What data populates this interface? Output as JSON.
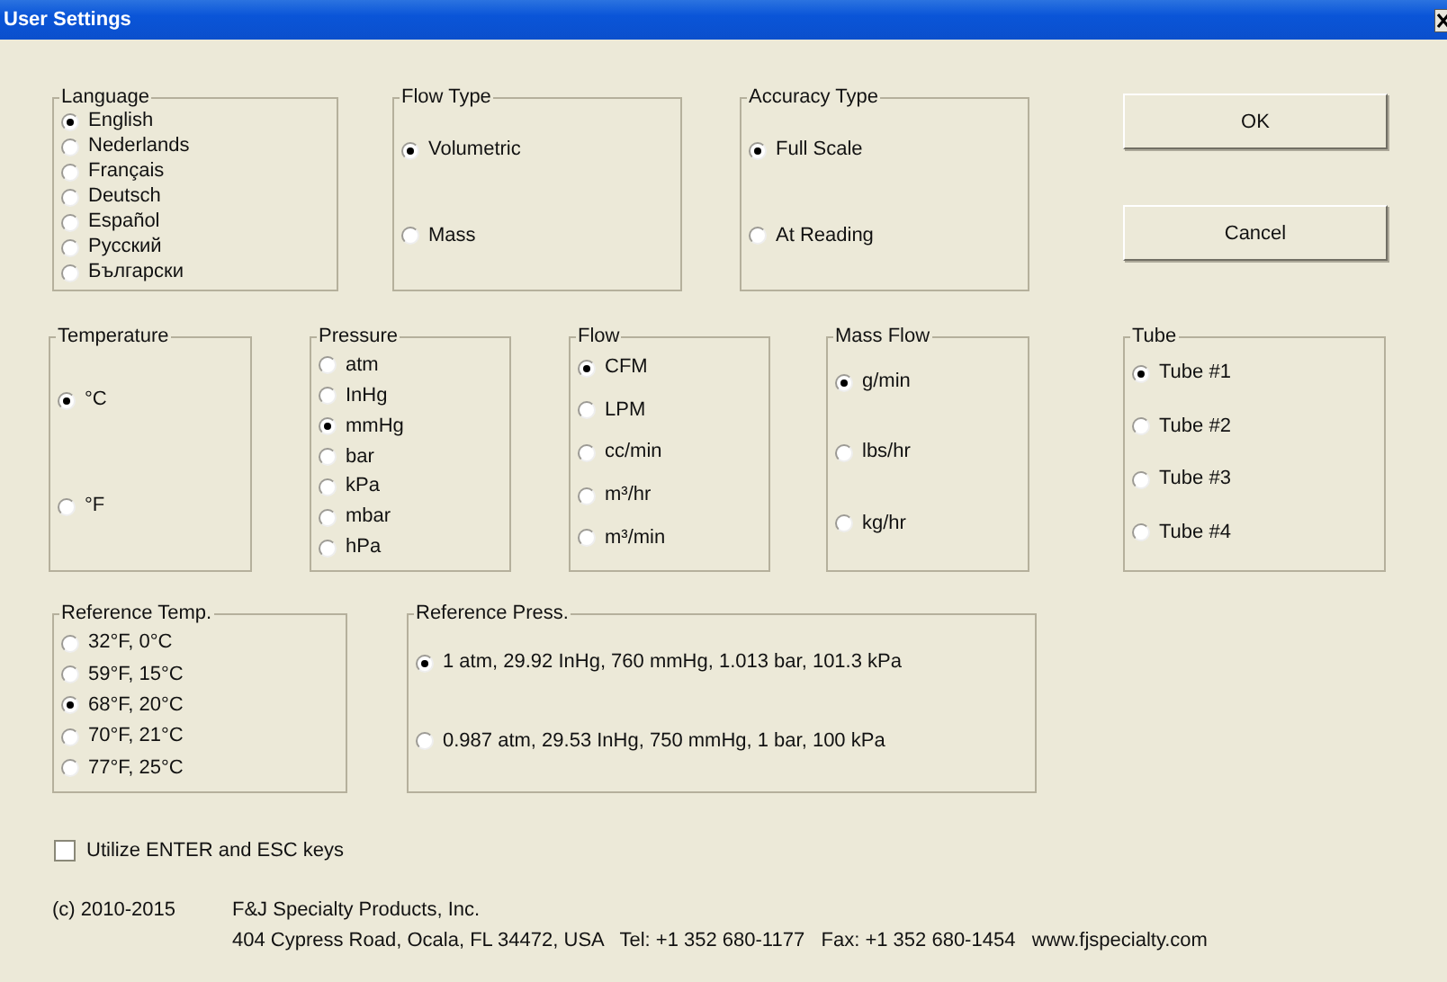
{
  "window": {
    "title": "User Settings"
  },
  "groups": [
    {
      "title": "Language",
      "options": [
        {
          "label": "English",
          "selected": true
        },
        {
          "label": "Nederlands",
          "selected": false
        },
        {
          "label": "Français",
          "selected": false
        },
        {
          "label": "Deutsch",
          "selected": false
        },
        {
          "label": "Español",
          "selected": false
        },
        {
          "label": "Русский",
          "selected": false
        },
        {
          "label": "Български",
          "selected": false
        }
      ]
    },
    {
      "title": "Flow Type",
      "options": [
        {
          "label": "Volumetric",
          "selected": true
        },
        {
          "label": "Mass",
          "selected": false
        }
      ]
    },
    {
      "title": "Accuracy Type",
      "options": [
        {
          "label": "Full Scale",
          "selected": true
        },
        {
          "label": "At Reading",
          "selected": false
        }
      ]
    },
    {
      "title": "Temperature",
      "options": [
        {
          "label": "°C",
          "selected": true
        },
        {
          "label": "°F",
          "selected": false
        }
      ]
    },
    {
      "title": "Pressure",
      "options": [
        {
          "label": "atm",
          "selected": false
        },
        {
          "label": "InHg",
          "selected": false
        },
        {
          "label": "mmHg",
          "selected": true
        },
        {
          "label": "bar",
          "selected": false
        },
        {
          "label": "kPa",
          "selected": false
        },
        {
          "label": "mbar",
          "selected": false
        },
        {
          "label": "hPa",
          "selected": false
        }
      ]
    },
    {
      "title": "Flow",
      "options": [
        {
          "label": "CFM",
          "selected": true
        },
        {
          "label": "LPM",
          "selected": false
        },
        {
          "label": "cc/min",
          "selected": false
        },
        {
          "label": "m³/hr",
          "selected": false
        },
        {
          "label": "m³/min",
          "selected": false
        }
      ]
    },
    {
      "title": "Mass Flow",
      "options": [
        {
          "label": "g/min",
          "selected": true
        },
        {
          "label": "lbs/hr",
          "selected": false
        },
        {
          "label": "kg/hr",
          "selected": false
        }
      ]
    },
    {
      "title": "Tube",
      "options": [
        {
          "label": "Tube #1",
          "selected": true
        },
        {
          "label": "Tube #2",
          "selected": false
        },
        {
          "label": "Tube #3",
          "selected": false
        },
        {
          "label": "Tube #4",
          "selected": false
        }
      ]
    },
    {
      "title": "Reference Temp.",
      "options": [
        {
          "label": "32°F, 0°C",
          "selected": false
        },
        {
          "label": "59°F, 15°C",
          "selected": false
        },
        {
          "label": "68°F, 20°C",
          "selected": true
        },
        {
          "label": "70°F, 21°C",
          "selected": false
        },
        {
          "label": "77°F, 25°C",
          "selected": false
        }
      ]
    },
    {
      "title": "Reference Press.",
      "options": [
        {
          "label": "1 atm, 29.92 InHg, 760 mmHg, 1.013 bar, 101.3 kPa",
          "selected": true
        },
        {
          "label": "0.987 atm, 29.53 InHg, 750 mmHg, 1 bar, 100 kPa",
          "selected": false
        }
      ]
    }
  ],
  "buttons": [
    {
      "label": "OK"
    },
    {
      "label": "Cancel"
    }
  ],
  "checkbox": {
    "label": "Utilize ENTER and ESC keys",
    "checked": false
  },
  "footer": {
    "copyright": "(c) 2010-2015",
    "company": "F&J Specialty Products, Inc.",
    "address": "404 Cypress Road, Ocala, FL 34472, USA   Tel: +1 352 680-1177   Fax: +1 352 680-1454   www.fjspecialty.com"
  }
}
